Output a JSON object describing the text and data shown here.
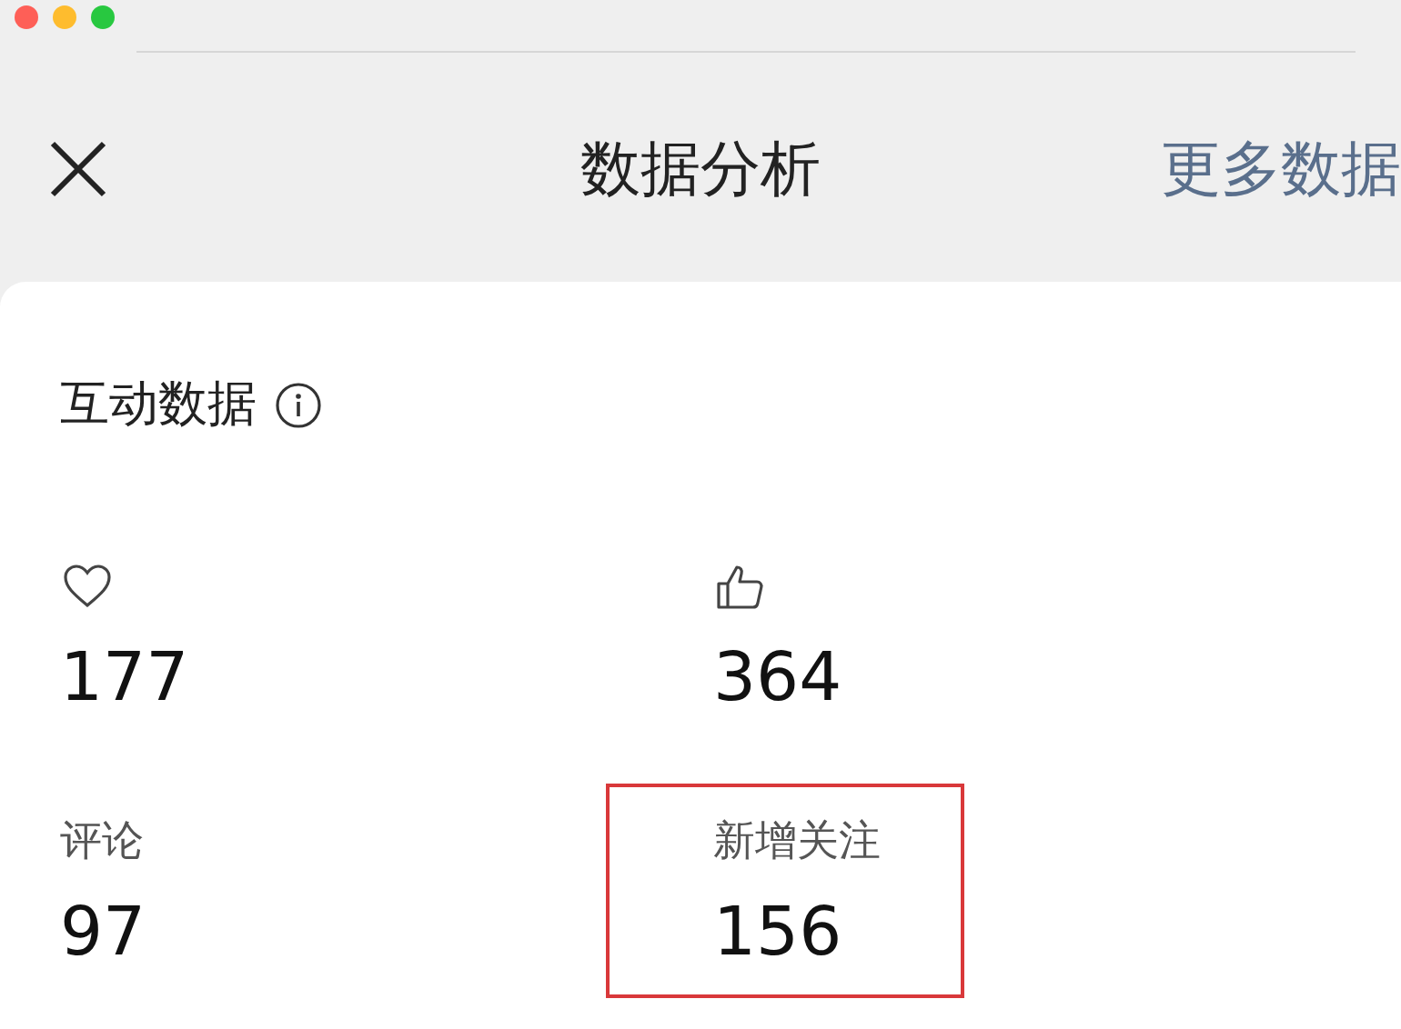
{
  "window": {
    "controls": [
      {
        "color": "#fe5f57"
      },
      {
        "color": "#febc2e"
      },
      {
        "color": "#28c840"
      }
    ]
  },
  "header": {
    "title": "数据分析",
    "action": "更多数据"
  },
  "section": {
    "title": "互动数据"
  },
  "metrics": [
    {
      "kind": "heart",
      "value": "177",
      "highlighted": false
    },
    {
      "kind": "thumb",
      "value": "364",
      "highlighted": false
    },
    {
      "kind": "label",
      "label": "评论",
      "value": "97",
      "highlighted": false
    },
    {
      "kind": "label",
      "label": "新增关注",
      "value": "156",
      "highlighted": true
    }
  ]
}
